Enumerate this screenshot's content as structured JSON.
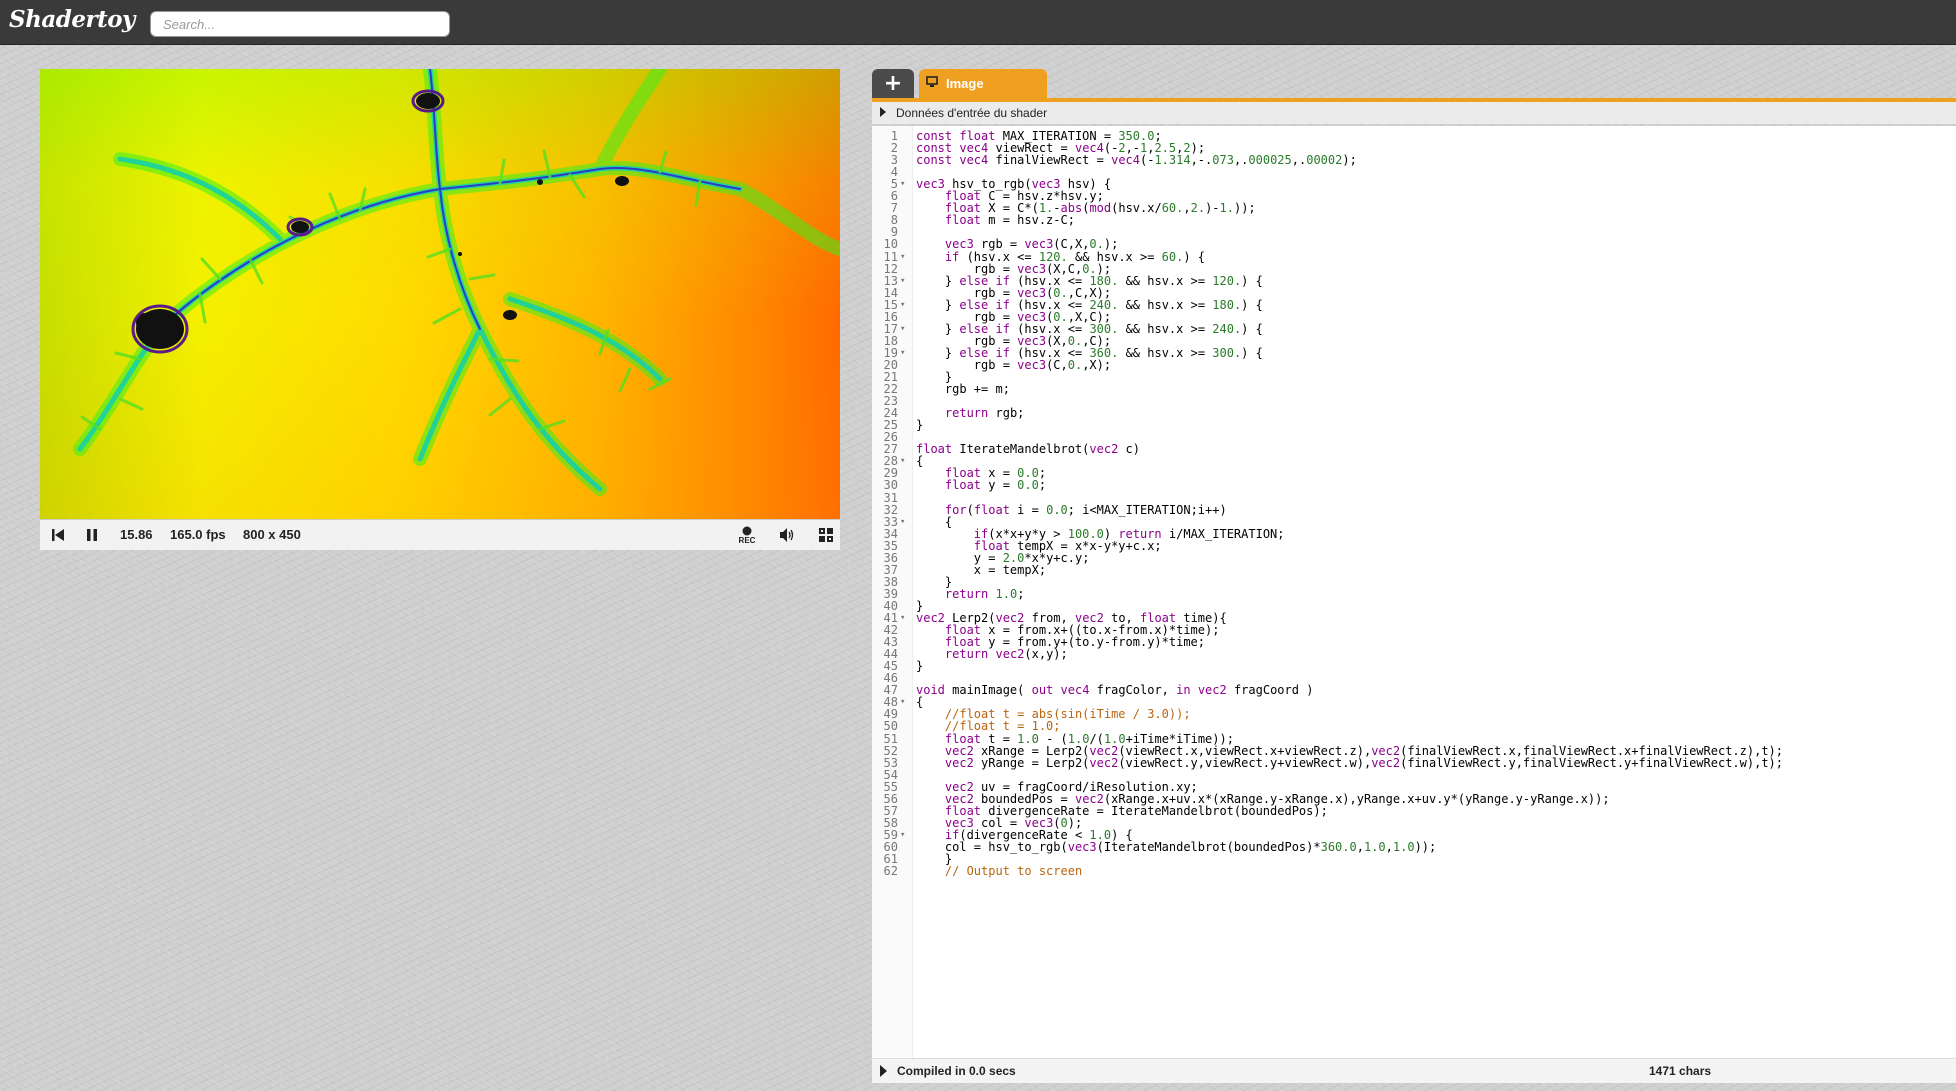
{
  "header": {
    "logo": "Shadertoy",
    "search_placeholder": "Search..."
  },
  "player": {
    "time": "15.86",
    "fps": "165.0 fps",
    "resolution": "800 x 450",
    "rec_label": "REC",
    "icons": [
      "rewind-icon",
      "pause-icon",
      "record-icon",
      "volume-icon",
      "fullscreen-icon"
    ]
  },
  "editor": {
    "tabs": {
      "add": "+",
      "image": "Image"
    },
    "inputs_label": "Données d'entrée du shader",
    "status": {
      "compiled": "Compiled in 0.0 secs",
      "chars": "1471 chars"
    },
    "lines": [
      "const float MAX_ITERATION = 350.0;",
      "const vec4 viewRect = vec4(-2,-1,2.5,2);",
      "const vec4 finalViewRect = vec4(-1.314,-.073,.000025,.00002);",
      "",
      "vec3 hsv_to_rgb(vec3 hsv) {",
      "    float C = hsv.z*hsv.y;",
      "    float X = C*(1.-abs(mod(hsv.x/60.,2.)-1.));",
      "    float m = hsv.z-C;",
      "",
      "    vec3 rgb = vec3(C,X,0.);",
      "    if (hsv.x <= 120. && hsv.x >= 60.) {",
      "        rgb = vec3(X,C,0.);",
      "    } else if (hsv.x <= 180. && hsv.x >= 120.) {",
      "        rgb = vec3(0.,C,X);",
      "    } else if (hsv.x <= 240. && hsv.x >= 180.) {",
      "        rgb = vec3(0.,X,C);",
      "    } else if (hsv.x <= 300. && hsv.x >= 240.) {",
      "        rgb = vec3(X,0.,C);",
      "    } else if (hsv.x <= 360. && hsv.x >= 300.) {",
      "        rgb = vec3(C,0.,X);",
      "    }",
      "    rgb += m;",
      "",
      "    return rgb;",
      "}",
      "",
      "float IterateMandelbrot(vec2 c)",
      "{",
      "    float x = 0.0;",
      "    float y = 0.0;",
      "",
      "    for(float i = 0.0; i<MAX_ITERATION;i++)",
      "    {",
      "        if(x*x+y*y > 100.0) return i/MAX_ITERATION;",
      "        float tempX = x*x-y*y+c.x;",
      "        y = 2.0*x*y+c.y;",
      "        x = tempX;",
      "    }",
      "    return 1.0;",
      "}",
      "vec2 Lerp2(vec2 from, vec2 to, float time){",
      "    float x = from.x+((to.x-from.x)*time);",
      "    float y = from.y+(to.y-from.y)*time;",
      "    return vec2(x,y);",
      "}",
      "",
      "void mainImage( out vec4 fragColor, in vec2 fragCoord )",
      "{",
      "    //float t = abs(sin(iTime / 3.0));",
      "    //float t = 1.0;",
      "    float t = 1.0 - (1.0/(1.0+iTime*iTime));",
      "    vec2 xRange = Lerp2(vec2(viewRect.x,viewRect.x+viewRect.z),vec2(finalViewRect.x,finalViewRect.x+finalViewRect.z),t);",
      "    vec2 yRange = Lerp2(vec2(viewRect.y,viewRect.y+viewRect.w),vec2(finalViewRect.y,finalViewRect.y+finalViewRect.w),t);",
      "",
      "    vec2 uv = fragCoord/iResolution.xy;",
      "    vec2 boundedPos = vec2(xRange.x+uv.x*(xRange.y-xRange.x),yRange.x+uv.y*(yRange.y-yRange.x));",
      "    float divergenceRate = IterateMandelbrot(boundedPos);",
      "    vec3 col = vec3(0);",
      "    if(divergenceRate < 1.0) {",
      "    col = hsv_to_rgb(vec3(IterateMandelbrot(boundedPos)*360.0,1.0,1.0));",
      "    }",
      "    // Output to screen"
    ],
    "fold_lines": [
      5,
      11,
      13,
      15,
      17,
      19,
      28,
      33,
      41,
      48,
      59
    ]
  },
  "colors": {
    "accent": "#f0a020",
    "topbar": "#3a3a3a",
    "keyword": "#8b008b",
    "number": "#2a7a2a",
    "comment": "#b8650f"
  }
}
